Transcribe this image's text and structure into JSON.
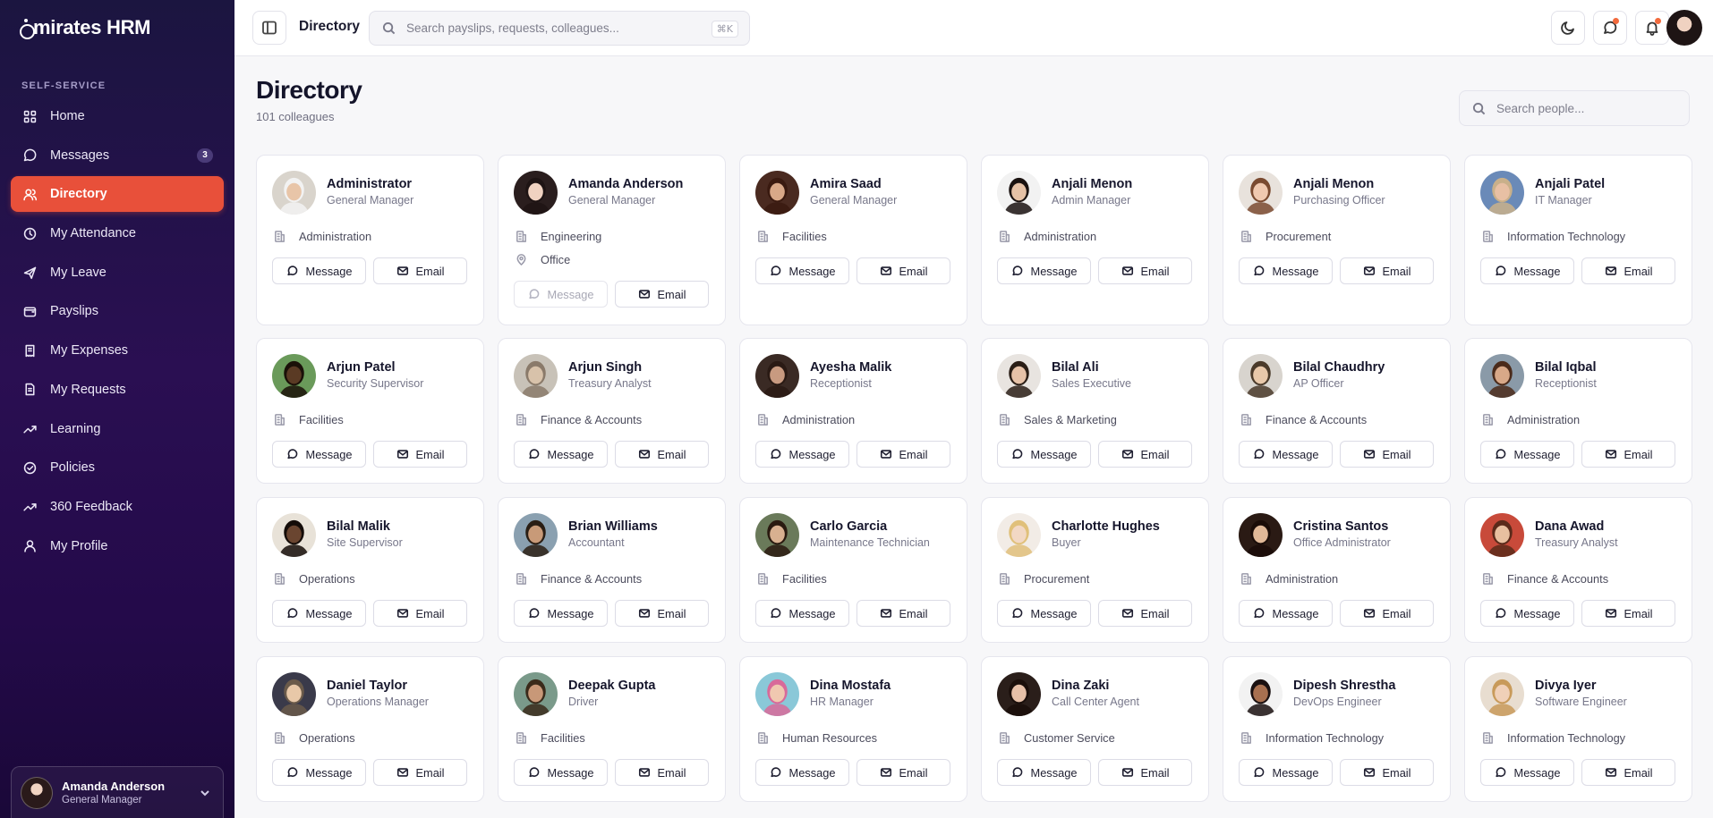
{
  "app": {
    "logo": "mirates HRM",
    "logo_prefix": "E"
  },
  "sidebar": {
    "section_label": "SELF-SERVICE",
    "items": [
      {
        "label": "Home",
        "icon": "grid-icon",
        "active": false
      },
      {
        "label": "Messages",
        "icon": "message-icon",
        "badge": "3",
        "active": false
      },
      {
        "label": "Directory",
        "icon": "users-icon",
        "active": true
      },
      {
        "label": "My Attendance",
        "icon": "clock-icon",
        "active": false
      },
      {
        "label": "My Leave",
        "icon": "plane-icon",
        "active": false
      },
      {
        "label": "Payslips",
        "icon": "wallet-icon",
        "active": false
      },
      {
        "label": "My Expenses",
        "icon": "receipt-icon",
        "active": false
      },
      {
        "label": "My Requests",
        "icon": "document-icon",
        "active": false
      },
      {
        "label": "Learning",
        "icon": "trending-icon",
        "active": false
      },
      {
        "label": "Policies",
        "icon": "check-circle-icon",
        "active": false
      },
      {
        "label": "360 Feedback",
        "icon": "trending-icon",
        "active": false
      },
      {
        "label": "My Profile",
        "icon": "user-icon",
        "active": false
      }
    ],
    "user": {
      "name": "Amanda Anderson",
      "role": "General Manager"
    }
  },
  "topbar": {
    "title": "Directory",
    "search_placeholder": "Search payslips, requests, colleagues...",
    "shortcut": "⌘K"
  },
  "page": {
    "title": "Directory",
    "subtitle": "101 colleagues",
    "search_placeholder": "Search people..."
  },
  "labels": {
    "message": "Message",
    "email": "Email"
  },
  "colors": {
    "accent": "#e8503a",
    "sidebar_top": "#1b1540",
    "sidebar_mid": "#2a0f52"
  },
  "people": [
    {
      "name": "Administrator",
      "role": "General Manager",
      "dept": "Administration",
      "skin": "#e8c5a8",
      "hair": "#f2f2f2",
      "bg": "#d9d4cc"
    },
    {
      "name": "Amanda Anderson",
      "role": "General Manager",
      "dept": "Engineering",
      "location": "Office",
      "message_disabled": true,
      "skin": "#f0d2c1",
      "hair": "#1e1414",
      "bg": "#2a1e1e"
    },
    {
      "name": "Amira Saad",
      "role": "General Manager",
      "dept": "Facilities",
      "skin": "#d8a888",
      "hair": "#3a1a10",
      "bg": "#4a2a20"
    },
    {
      "name": "Anjali Menon",
      "role": "Admin Manager",
      "dept": "Administration",
      "skin": "#e6c2a6",
      "hair": "#1a1210",
      "bg": "#f2f2f2"
    },
    {
      "name": "Anjali Menon",
      "role": "Purchasing Officer",
      "dept": "Procurement",
      "skin": "#f0c9b0",
      "hair": "#7a4a30",
      "bg": "#e8e2dc"
    },
    {
      "name": "Anjali Patel",
      "role": "IT Manager",
      "dept": "Information Technology",
      "skin": "#e8c0a4",
      "hair": "#c9b08a",
      "bg": "#6a8ab8"
    },
    {
      "name": "Arjun Patel",
      "role": "Security Supervisor",
      "dept": "Facilities",
      "skin": "#5a3a24",
      "hair": "#1a1008",
      "bg": "#6a9a5a"
    },
    {
      "name": "Arjun Singh",
      "role": "Treasury Analyst",
      "dept": "Finance & Accounts",
      "skin": "#d8c2aa",
      "hair": "#8a7a6a",
      "bg": "#c8c2b8"
    },
    {
      "name": "Ayesha Malik",
      "role": "Receptionist",
      "dept": "Administration",
      "skin": "#c89a80",
      "hair": "#2a1a14",
      "bg": "#3a2a24"
    },
    {
      "name": "Bilal Ali",
      "role": "Sales Executive",
      "dept": "Sales & Marketing",
      "skin": "#e6c2a8",
      "hair": "#2a1e16",
      "bg": "#e8e4e0"
    },
    {
      "name": "Bilal Chaudhry",
      "role": "AP Officer",
      "dept": "Finance & Accounts",
      "skin": "#e8c8aa",
      "hair": "#4a3a2a",
      "bg": "#d8d4ce"
    },
    {
      "name": "Bilal Iqbal",
      "role": "Receptionist",
      "dept": "Administration",
      "skin": "#d8a888",
      "hair": "#4a2a1a",
      "bg": "#8a9aa8"
    },
    {
      "name": "Bilal Malik",
      "role": "Site Supervisor",
      "dept": "Operations",
      "skin": "#6a4530",
      "hair": "#140c08",
      "bg": "#e8e2d8"
    },
    {
      "name": "Brian Williams",
      "role": "Accountant",
      "dept": "Finance & Accounts",
      "skin": "#c89a78",
      "hair": "#2a1e14",
      "bg": "#8aa0b0"
    },
    {
      "name": "Carlo Garcia",
      "role": "Maintenance Technician",
      "dept": "Facilities",
      "skin": "#d8b090",
      "hair": "#2a1a10",
      "bg": "#6a7a5a"
    },
    {
      "name": "Charlotte Hughes",
      "role": "Buyer",
      "dept": "Procurement",
      "skin": "#f2d8c4",
      "hair": "#e0c07a",
      "bg": "#f2ece6"
    },
    {
      "name": "Cristina Santos",
      "role": "Office Administrator",
      "dept": "Administration",
      "skin": "#e0b898",
      "hair": "#1a0c08",
      "bg": "#2a1a14"
    },
    {
      "name": "Dana Awad",
      "role": "Treasury Analyst",
      "dept": "Finance & Accounts",
      "skin": "#e8c0a0",
      "hair": "#5a2a1a",
      "bg": "#c84a3a"
    },
    {
      "name": "Daniel Taylor",
      "role": "Operations Manager",
      "dept": "Operations",
      "skin": "#e8c8a8",
      "hair": "#6a5a4a",
      "bg": "#3a3a4a"
    },
    {
      "name": "Deepak Gupta",
      "role": "Driver",
      "dept": "Facilities",
      "skin": "#c89878",
      "hair": "#3a2a1a",
      "bg": "#7a9a8a"
    },
    {
      "name": "Dina Mostafa",
      "role": "HR Manager",
      "dept": "Human Resources",
      "skin": "#f0c8b0",
      "hair": "#d86a9a",
      "bg": "#8ac8d8"
    },
    {
      "name": "Dina Zaki",
      "role": "Call Center Agent",
      "dept": "Customer Service",
      "skin": "#e6c0a8",
      "hair": "#1a0e0a",
      "bg": "#2a1e1a"
    },
    {
      "name": "Dipesh Shrestha",
      "role": "DevOps Engineer",
      "dept": "Information Technology",
      "skin": "#a87050",
      "hair": "#1a1010",
      "bg": "#f2f2f2"
    },
    {
      "name": "Divya Iyer",
      "role": "Software Engineer",
      "dept": "Information Technology",
      "skin": "#f0d0b8",
      "hair": "#c89a5a",
      "bg": "#e8ddd0"
    }
  ]
}
